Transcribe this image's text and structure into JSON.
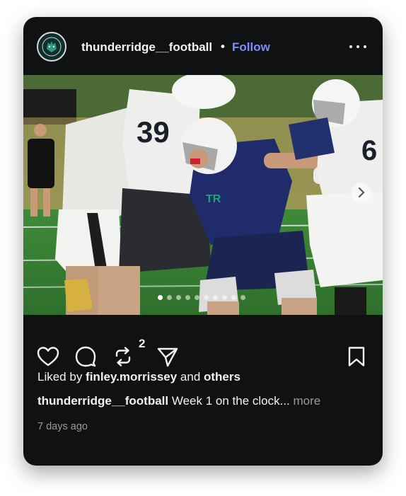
{
  "post": {
    "username": "thunderridge__football",
    "separator": "•",
    "follow_label": "Follow",
    "avatar_icon": "team-logo-icon",
    "more_icon": "more-options-icon"
  },
  "media": {
    "slide_count": 10,
    "active_slide": 1,
    "next_icon": "chevron-right-icon"
  },
  "actions": {
    "like_icon": "heart-icon",
    "comment_icon": "comment-bubble-icon",
    "repost_icon": "repost-icon",
    "repost_count": "2",
    "share_icon": "send-icon",
    "save_icon": "bookmark-icon"
  },
  "likes": {
    "prefix": "Liked by ",
    "user": "finley.morrissey",
    "middle": " and ",
    "others": "others"
  },
  "caption": {
    "username": "thunderridge__football",
    "text": " Week 1 on the clock...",
    "more_label": " more"
  },
  "timestamp": "7 days ago",
  "colors": {
    "card_bg": "#101113",
    "follow": "#7b8cff",
    "muted": "#9a9a9a"
  }
}
